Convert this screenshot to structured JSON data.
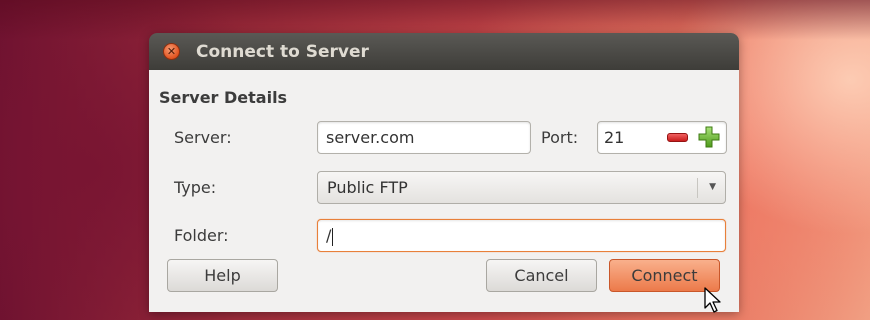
{
  "window": {
    "title": "Connect to Server"
  },
  "section": {
    "title": "Server Details"
  },
  "server": {
    "label": "Server:",
    "value": "server.com"
  },
  "port": {
    "label": "Port:",
    "value": "21"
  },
  "type": {
    "label": "Type:",
    "selected": "Public FTP"
  },
  "folder": {
    "label": "Folder:",
    "value": "/"
  },
  "buttons": {
    "help": "Help",
    "cancel": "Cancel",
    "connect": "Connect"
  },
  "colors": {
    "accent": "#ec7a4a",
    "focus_border": "#e8803a",
    "titlebar": "#3e3d39",
    "dialog_bg": "#f2f1f0"
  },
  "icons": {
    "close": "close-icon",
    "decrement": "minus-icon",
    "increment": "plus-icon",
    "dropdown": "chevron-down-icon",
    "pointer": "mouse-pointer-icon"
  }
}
